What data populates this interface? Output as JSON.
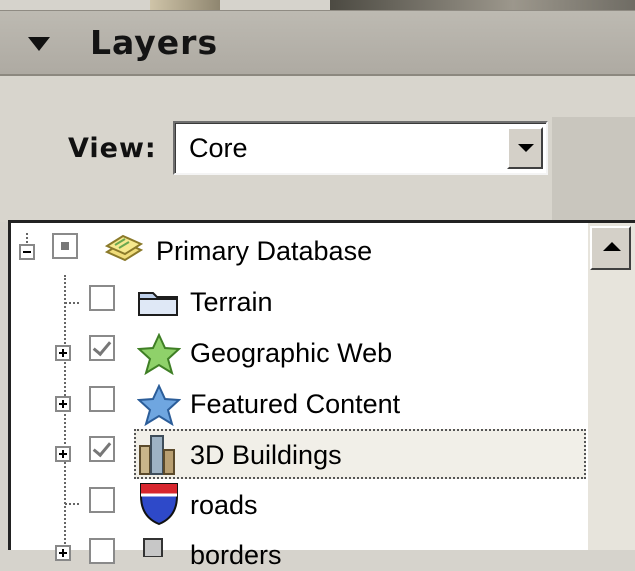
{
  "panel": {
    "title": "Layers",
    "collapse_icon": "triangle-down-icon"
  },
  "view": {
    "label": "View:",
    "selected": "Core"
  },
  "tree": {
    "items": [
      {
        "label": "Primary Database",
        "checked": "partial",
        "expander": "minus",
        "icon": "database-icon"
      },
      {
        "label": "Terrain",
        "checked": "unchecked",
        "expander": "none",
        "icon": "folder-icon"
      },
      {
        "label": "Geographic Web",
        "checked": "checked",
        "expander": "plus",
        "icon": "green-star-icon"
      },
      {
        "label": "Featured Content",
        "checked": "unchecked",
        "expander": "plus",
        "icon": "blue-star-icon"
      },
      {
        "label": "3D Buildings",
        "checked": "checked",
        "expander": "plus",
        "icon": "buildings-icon",
        "selected": true
      },
      {
        "label": "roads",
        "checked": "unchecked",
        "expander": "none",
        "icon": "highway-shield-icon"
      },
      {
        "label": "borders",
        "checked": "unchecked",
        "expander": "plus",
        "icon": "border-icon"
      }
    ]
  }
}
